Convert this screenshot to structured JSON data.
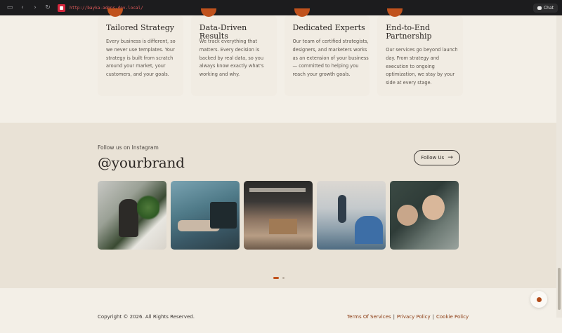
{
  "browser": {
    "url": "http://bayka-adons-dev.local/",
    "chat_label": "Chat"
  },
  "features": [
    {
      "title": "Tailored Strategy",
      "body": "Every business is different, so we never use templates. Your strategy is built from scratch around your market, your customers, and your goals."
    },
    {
      "title": "Data-Driven Results",
      "body": "We track everything that matters. Every decision is backed by real data, so you always know exactly what's working and why."
    },
    {
      "title": "Dedicated Experts",
      "body": "Our team of certified strategists, designers, and marketers works as an extension of your business — committed to helping you reach your growth goals."
    },
    {
      "title": "End-to-End Partnership",
      "body": "Our services go beyond launch day. From strategy and execution to ongoing optimization, we stay by your side at every stage."
    }
  ],
  "instagram": {
    "label": "Follow us on Instagram",
    "handle": "@yourbrand",
    "button_label": "Follow Us",
    "carousel_active_index": 0,
    "carousel_pages": 2
  },
  "footer": {
    "copyright": "Copyright © 2026. All Rights Reserved.",
    "links": [
      "Terms Of Services",
      "Privacy Policy",
      "Cookie Policy"
    ],
    "separator": "|"
  },
  "colors": {
    "accent": "#c0521d",
    "link": "#8a3a12",
    "background": "#f3efe7",
    "section_bg": "#e9e2d6"
  }
}
